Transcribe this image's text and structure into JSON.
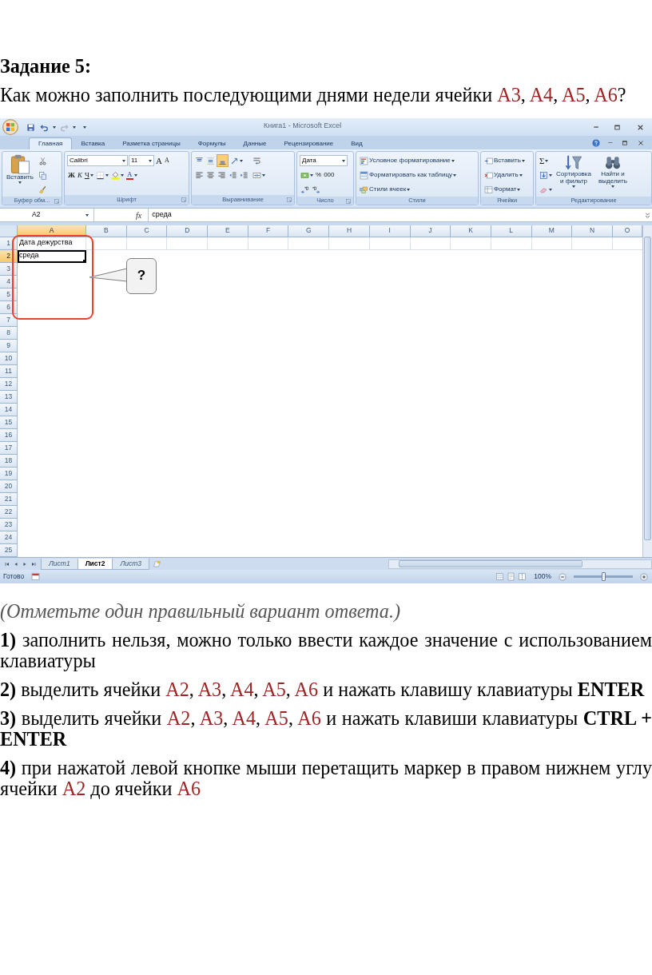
{
  "task": {
    "title": "Задание 5:",
    "question": [
      {
        "kind": "plain",
        "text": "Как можно заполнить последующими днями недели ячейки "
      },
      {
        "kind": "ref",
        "text": "A3"
      },
      {
        "kind": "plain",
        "text": ", "
      },
      {
        "kind": "ref",
        "text": "A4"
      },
      {
        "kind": "plain",
        "text": ", "
      },
      {
        "kind": "ref",
        "text": "A5"
      },
      {
        "kind": "plain",
        "text": ", "
      },
      {
        "kind": "ref",
        "text": "A6"
      },
      {
        "kind": "plain",
        "text": "?"
      }
    ]
  },
  "excel": {
    "window_title": "Книга1 - Microsoft Excel",
    "tabs": [
      {
        "label": "Главная",
        "selected": true
      },
      {
        "label": "Вставка",
        "selected": false
      },
      {
        "label": "Разметка страницы",
        "selected": false
      },
      {
        "label": "Формулы",
        "selected": false
      },
      {
        "label": "Данные",
        "selected": false
      },
      {
        "label": "Рецензирование",
        "selected": false
      },
      {
        "label": "Вид",
        "selected": false
      }
    ],
    "ribbon": [
      {
        "label": "Буфер обм...",
        "launcher": true,
        "parts": [
          {
            "kind": "large",
            "control": {
              "kind": "paste",
              "text": "Вставить",
              "dropdown": true
            }
          },
          {
            "kind": "stack",
            "rows": [
              {
                "controls": [
                  {
                    "kind": "scissors"
                  }
                ]
              },
              {
                "controls": [
                  {
                    "kind": "copy"
                  }
                ]
              },
              {
                "controls": [
                  {
                    "kind": "brush"
                  }
                ]
              }
            ]
          }
        ]
      },
      {
        "label": "Шрифт",
        "launcher": true,
        "parts": [
          {
            "kind": "stack",
            "rows": [
              {
                "controls": [
                  {
                    "kind": "combo",
                    "text": "Calibri"
                  },
                  {
                    "kind": "combo",
                    "text": "11"
                  },
                  {
                    "kind": "grow",
                    "text": "A"
                  },
                  {
                    "kind": "shrink",
                    "text": "A"
                  }
                ]
              },
              {
                "controls": [
                  {
                    "kind": "bold",
                    "text": "Ж"
                  },
                  {
                    "kind": "italic",
                    "text": "К"
                  },
                  {
                    "kind": "underline",
                    "text": "Ч",
                    "dropdown": true
                  },
                  {
                    "kind": "borders",
                    "dropdown": true
                  },
                  {
                    "kind": "fill",
                    "dropdown": true
                  },
                  {
                    "kind": "fontcolor",
                    "text": "A",
                    "dropdown": true
                  }
                ]
              }
            ]
          }
        ]
      },
      {
        "label": "Выравнивание",
        "launcher": true,
        "parts": [
          {
            "kind": "stack",
            "rows": [
              {
                "controls": [
                  {
                    "kind": "top",
                    "selected": false
                  },
                  {
                    "kind": "middle",
                    "selected": false
                  },
                  {
                    "kind": "bottom",
                    "selected": true
                  },
                  {
                    "kind": "orientation",
                    "dropdown": true
                  }
                ]
              },
              {
                "controls": [
                  {
                    "kind": "left",
                    "selected": false
                  },
                  {
                    "kind": "center",
                    "selected": false
                  },
                  {
                    "kind": "right",
                    "selected": false
                  },
                  {
                    "kind": "outdent"
                  },
                  {
                    "kind": "indent"
                  }
                ]
              }
            ]
          },
          {
            "kind": "stack",
            "rows": [
              {
                "controls": [
                  {
                    "kind": "wrap"
                  }
                ]
              },
              {
                "controls": [
                  {
                    "kind": "merge",
                    "dropdown": true
                  }
                ]
              }
            ]
          }
        ]
      },
      {
        "label": "Число",
        "launcher": true,
        "parts": [
          {
            "kind": "stack",
            "rows": [
              {
                "controls": [
                  {
                    "kind": "combo",
                    "text": "Дата"
                  }
                ]
              },
              {
                "controls": [
                  {
                    "kind": "money",
                    "dropdown": true
                  },
                  {
                    "kind": "percent",
                    "text": "%"
                  },
                  {
                    "kind": "thousands",
                    "text": "000"
                  }
                ]
              },
              {
                "controls": [
                  {
                    "kind": "moredec"
                  },
                  {
                    "kind": "fewerdec"
                  }
                ]
              }
            ]
          }
        ]
      },
      {
        "label": "Стили",
        "launcher": false,
        "parts": [
          {
            "kind": "stack",
            "rows": [
              {
                "controls": [
                  {
                    "kind": "conditional",
                    "text": "Условное форматирование",
                    "dropdown": true
                  }
                ]
              },
              {
                "controls": [
                  {
                    "kind": "tableformat",
                    "text": "Форматировать как таблицу",
                    "dropdown": true
                  }
                ]
              },
              {
                "controls": [
                  {
                    "kind": "cellstyle",
                    "text": "Стили ячеек",
                    "dropdown": true
                  }
                ]
              }
            ]
          }
        ]
      },
      {
        "label": "Ячейки",
        "launcher": false,
        "parts": [
          {
            "kind": "stack",
            "rows": [
              {
                "controls": [
                  {
                    "kind": "insertcell",
                    "text": "Вставить",
                    "dropdown": true
                  }
                ]
              },
              {
                "controls": [
                  {
                    "kind": "deletecell",
                    "text": "Удалить",
                    "dropdown": true
                  }
                ]
              },
              {
                "controls": [
                  {
                    "kind": "formatcell",
                    "text": "Формат",
                    "dropdown": true
                  }
                ]
              }
            ]
          }
        ]
      },
      {
        "label": "Редактирование",
        "launcher": false,
        "parts": [
          {
            "kind": "stack",
            "rows": [
              {
                "controls": [
                  {
                    "kind": "sum",
                    "text": "Σ",
                    "dropdown": true
                  }
                ]
              },
              {
                "controls": [
                  {
                    "kind": "filldown",
                    "dropdown": true
                  }
                ]
              },
              {
                "controls": [
                  {
                    "kind": "eraser",
                    "dropdown": true
                  }
                ]
              }
            ]
          },
          {
            "kind": "large",
            "control": {
              "kind": "sort",
              "text": "Сортировка и фильтр",
              "dropdown": true
            }
          },
          {
            "kind": "large",
            "control": {
              "kind": "find",
              "text": "Найти и выделить",
              "dropdown": true
            }
          }
        ]
      }
    ],
    "name_box": "A2",
    "function_label": "fx",
    "formula": "среда",
    "columns": [
      {
        "label": "A",
        "selected": true
      },
      {
        "label": "B",
        "selected": false
      },
      {
        "label": "C",
        "selected": false
      },
      {
        "label": "D",
        "selected": false
      },
      {
        "label": "E",
        "selected": false
      },
      {
        "label": "F",
        "selected": false
      },
      {
        "label": "G",
        "selected": false
      },
      {
        "label": "H",
        "selected": false
      },
      {
        "label": "I",
        "selected": false
      },
      {
        "label": "J",
        "selected": false
      },
      {
        "label": "K",
        "selected": false
      },
      {
        "label": "L",
        "selected": false
      },
      {
        "label": "M",
        "selected": false
      },
      {
        "label": "N",
        "selected": false
      },
      {
        "label": "O",
        "selected": false
      }
    ],
    "rows": [
      {
        "label": "1",
        "selected": false,
        "value": "Дата дежурства"
      },
      {
        "label": "2",
        "selected": true,
        "value": "среда"
      },
      {
        "label": "3",
        "selected": false
      },
      {
        "label": "4",
        "selected": false
      },
      {
        "label": "5",
        "selected": false
      },
      {
        "label": "6",
        "selected": false
      },
      {
        "label": "7",
        "selected": false
      },
      {
        "label": "8",
        "selected": false
      },
      {
        "label": "9",
        "selected": false
      },
      {
        "label": "10",
        "selected": false
      },
      {
        "label": "11",
        "selected": false
      },
      {
        "label": "12",
        "selected": false
      },
      {
        "label": "13",
        "selected": false
      },
      {
        "label": "14",
        "selected": false
      },
      {
        "label": "15",
        "selected": false
      },
      {
        "label": "16",
        "selected": false
      },
      {
        "label": "17",
        "selected": false
      },
      {
        "label": "18",
        "selected": false
      },
      {
        "label": "19",
        "selected": false
      },
      {
        "label": "20",
        "selected": false
      },
      {
        "label": "21",
        "selected": false
      },
      {
        "label": "22",
        "selected": false
      },
      {
        "label": "23",
        "selected": false
      },
      {
        "label": "24",
        "selected": false
      },
      {
        "label": "25",
        "selected": false
      }
    ],
    "callout": "?",
    "sheets": [
      {
        "label": "Лист1",
        "selected": false
      },
      {
        "label": "Лист2",
        "selected": true
      },
      {
        "label": "Лист3",
        "selected": false
      }
    ],
    "status": "Готово",
    "zoom": {
      "reading": "100%",
      "level": 0.5
    }
  },
  "instruction": "(Отметьте один правильный вариант ответа.)",
  "options": [
    {
      "number": "1)",
      "text": [
        {
          "kind": "plain",
          "text": "заполнить нельзя, можно только ввести каждое значение с использованием клавиатуры"
        }
      ]
    },
    {
      "number": "2)",
      "text": [
        {
          "kind": "plain",
          "text": "выделить ячейки "
        },
        {
          "kind": "ref",
          "text": "A2"
        },
        {
          "kind": "plain",
          "text": ", "
        },
        {
          "kind": "ref",
          "text": "A3"
        },
        {
          "kind": "plain",
          "text": ", "
        },
        {
          "kind": "ref",
          "text": "A4"
        },
        {
          "kind": "plain",
          "text": ", "
        },
        {
          "kind": "ref",
          "text": "A5"
        },
        {
          "kind": "plain",
          "text": ", "
        },
        {
          "kind": "ref",
          "text": "A6"
        },
        {
          "kind": "plain",
          "text": " и нажать клавишу клавиатуры "
        },
        {
          "kind": "key",
          "text": "ENTER"
        }
      ]
    },
    {
      "number": "3)",
      "text": [
        {
          "kind": "plain",
          "text": "выделить ячейки "
        },
        {
          "kind": "ref",
          "text": "A2"
        },
        {
          "kind": "plain",
          "text": ", "
        },
        {
          "kind": "ref",
          "text": "A3"
        },
        {
          "kind": "plain",
          "text": ", "
        },
        {
          "kind": "ref",
          "text": "A4"
        },
        {
          "kind": "plain",
          "text": ", "
        },
        {
          "kind": "ref",
          "text": "A5"
        },
        {
          "kind": "plain",
          "text": ", "
        },
        {
          "kind": "ref",
          "text": "A6"
        },
        {
          "kind": "plain",
          "text": " и нажать клавиши клавиатуры "
        },
        {
          "kind": "key",
          "text": "CTRL + ENTER"
        }
      ]
    },
    {
      "number": "4)",
      "text": [
        {
          "kind": "plain",
          "text": "при нажатой левой кнопке мыши перетащить маркер в правом нижнем углу ячейки "
        },
        {
          "kind": "ref",
          "text": "A2"
        },
        {
          "kind": "plain",
          "text": " до ячейки "
        },
        {
          "kind": "ref",
          "text": "A6"
        }
      ]
    }
  ]
}
